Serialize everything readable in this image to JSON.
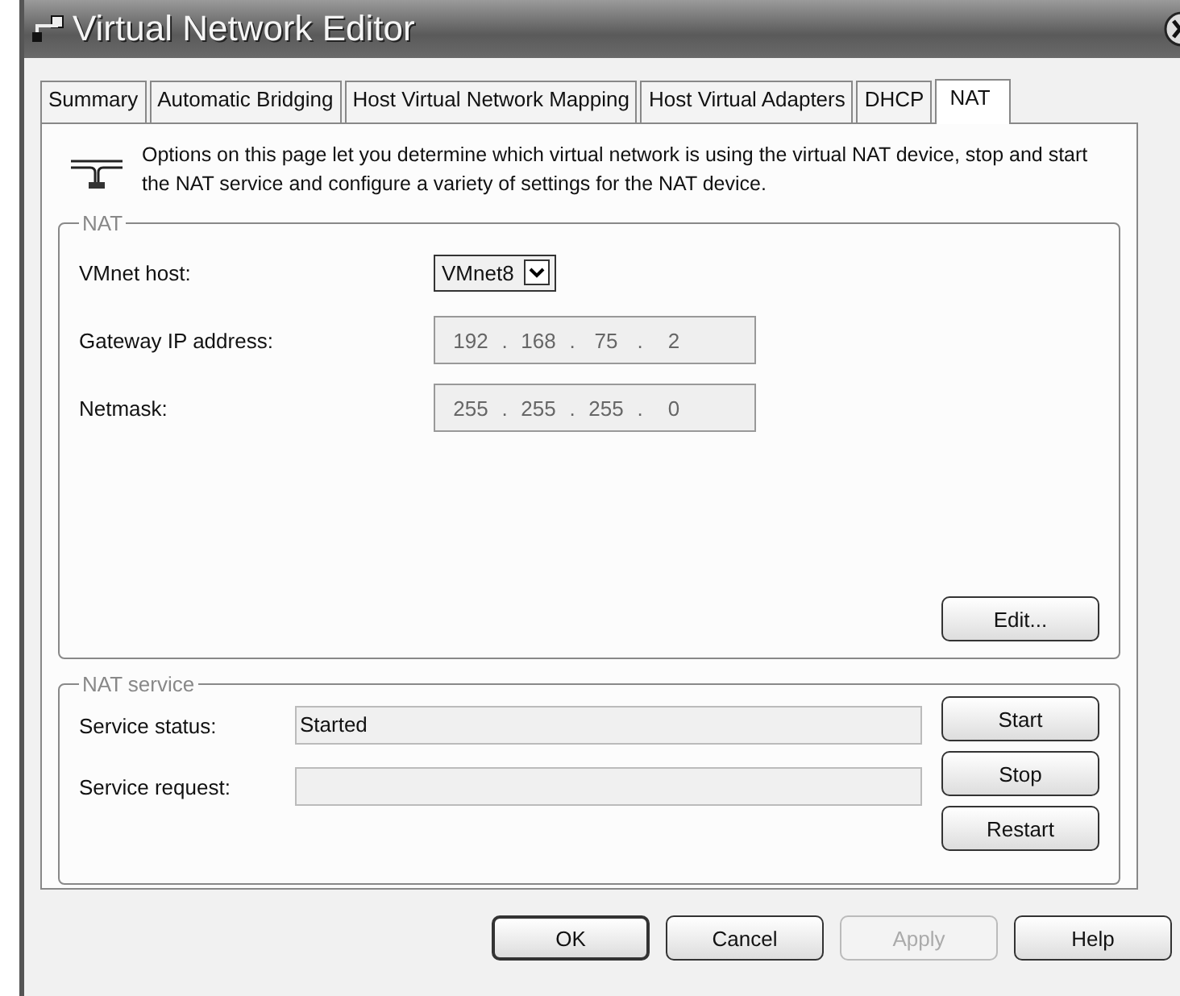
{
  "window": {
    "title": "Virtual Network Editor"
  },
  "tabs": [
    {
      "label": "Summary",
      "selected": false
    },
    {
      "label": "Automatic Bridging",
      "selected": false
    },
    {
      "label": "Host Virtual Network Mapping",
      "selected": false
    },
    {
      "label": "Host Virtual Adapters",
      "selected": false
    },
    {
      "label": "DHCP",
      "selected": false
    },
    {
      "label": "NAT",
      "selected": true
    }
  ],
  "description": "Options on this page let you determine which virtual network is using the virtual NAT device, stop and start the NAT service and configure a variety of settings for the NAT device.",
  "nat": {
    "legend": "NAT",
    "vmnet_host": {
      "label": "VMnet host:",
      "value": "VMnet8"
    },
    "fields": [
      {
        "label": "Gateway IP address:",
        "segments": [
          "192",
          "168",
          "75",
          "2"
        ],
        "separator": "."
      },
      {
        "label": "Netmask:",
        "segments": [
          "255",
          "255",
          "255",
          "0"
        ],
        "separator": "."
      }
    ],
    "edit_button": "Edit..."
  },
  "nat_service": {
    "legend": "NAT service",
    "rows": [
      {
        "label": "Service status:",
        "value": "Started"
      },
      {
        "label": "Service request:"
      }
    ],
    "buttons": [
      "Start",
      "Stop",
      "Restart"
    ]
  },
  "buttons": [
    {
      "label": "OK",
      "default": true,
      "disabled": false
    },
    {
      "label": "Cancel",
      "default": false,
      "disabled": false
    },
    {
      "label": "Apply",
      "default": false,
      "disabled": true
    },
    {
      "label": "Help",
      "default": false,
      "disabled": false
    }
  ]
}
